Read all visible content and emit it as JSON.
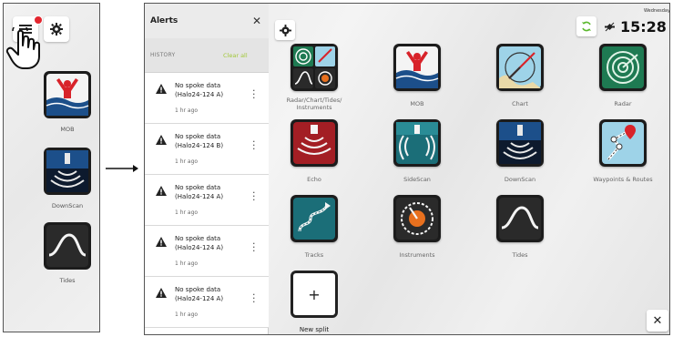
{
  "left_panel": {
    "apps": [
      {
        "label": "MOB",
        "icon": "mob-icon"
      },
      {
        "label": "DownScan",
        "icon": "downscan-icon"
      },
      {
        "label": "Tides",
        "icon": "tides-icon"
      }
    ]
  },
  "alerts": {
    "title": "Alerts",
    "close": "✕",
    "history_label": "HISTORY",
    "clear_all": "Clear all",
    "items": [
      {
        "title": "No spoke data",
        "subtitle": "(Halo24-124 A)",
        "time": "1 hr ago"
      },
      {
        "title": "No spoke data",
        "subtitle": "(Halo24-124 B)",
        "time": "1 hr ago"
      },
      {
        "title": "No spoke data",
        "subtitle": "(Halo24-124 A)",
        "time": "1 hr ago"
      },
      {
        "title": "No spoke data",
        "subtitle": "(Halo24-124 A)",
        "time": "1 hr ago"
      },
      {
        "title": "No spoke data",
        "subtitle": "(Halo24-124 A)",
        "time": "1 hr ago"
      }
    ]
  },
  "status": {
    "day": "Wednesday",
    "time": "15:28"
  },
  "grid_apps": [
    {
      "label": "Radar/Chart/Tides/\nInstruments",
      "icon": "multi-split-icon"
    },
    {
      "label": "MOB",
      "icon": "mob-icon"
    },
    {
      "label": "Chart",
      "icon": "chart-icon"
    },
    {
      "label": "Radar",
      "icon": "radar-icon"
    },
    {
      "label": "Echo",
      "icon": "echo-icon"
    },
    {
      "label": "SideScan",
      "icon": "sidescan-icon"
    },
    {
      "label": "DownScan",
      "icon": "downscan-icon"
    },
    {
      "label": "Waypoints & Routes",
      "icon": "waypoints-icon"
    },
    {
      "label": "Tracks",
      "icon": "tracks-icon"
    },
    {
      "label": "Instruments",
      "icon": "instruments-icon"
    },
    {
      "label": "Tides",
      "icon": "tides-icon"
    }
  ],
  "new_split": {
    "symbol": "+",
    "label": "New split"
  },
  "close_button": "✕",
  "colors": {
    "accent_green": "#a2c83a",
    "badge_red": "#e3262f",
    "mob_red": "#d8232a",
    "sea_blue": "#1c4f8a"
  }
}
